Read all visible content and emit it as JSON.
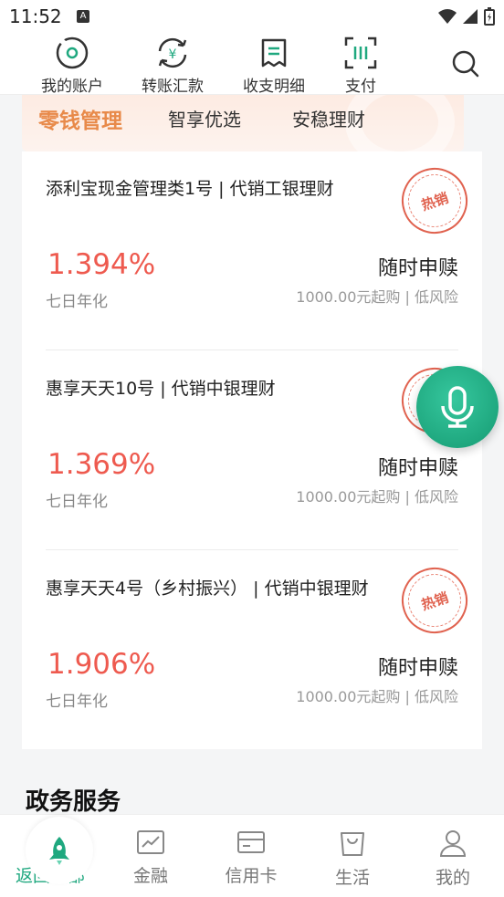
{
  "status_bar": {
    "time": "11:52"
  },
  "quick_actions": [
    {
      "label": "我的账户",
      "icon": "account-icon"
    },
    {
      "label": "转账汇款",
      "icon": "transfer-icon"
    },
    {
      "label": "收支明细",
      "icon": "statement-icon"
    },
    {
      "label": "支付",
      "icon": "scan-pay-icon"
    }
  ],
  "tabs": [
    {
      "label": "零钱管理",
      "active": true
    },
    {
      "label": "智享优选",
      "active": false
    },
    {
      "label": "安稳理财",
      "active": false
    }
  ],
  "products": [
    {
      "name": "添利宝现金管理类1号 | 代销工银理财",
      "rate": "1.394%",
      "rate_label": "七日年化",
      "redeem": "随时申赎",
      "min_buy": "1000.00元起购 | 低风险",
      "stamp": "热销"
    },
    {
      "name": "惠享天天10号 | 代销中银理财",
      "rate": "1.369%",
      "rate_label": "七日年化",
      "redeem": "随时申赎",
      "min_buy": "1000.00元起购 | 低风险",
      "stamp": "热销"
    },
    {
      "name": "惠享天天4号（乡村振兴） | 代销中银理财",
      "rate": "1.906%",
      "rate_label": "七日年化",
      "redeem": "随时申赎",
      "min_buy": "1000.00元起购 | 低风险",
      "stamp": "热销"
    }
  ],
  "section_title": "政务服务",
  "bottom_nav": [
    {
      "label": "返回顶部",
      "icon": "rocket-icon",
      "active": true
    },
    {
      "label": "金融",
      "icon": "chart-icon",
      "active": false
    },
    {
      "label": "信用卡",
      "icon": "card-icon",
      "active": false
    },
    {
      "label": "生活",
      "icon": "bag-icon",
      "active": false
    },
    {
      "label": "我的",
      "icon": "user-icon",
      "active": false
    }
  ],
  "colors": {
    "accent_green": "#1fa87f",
    "rate_red": "#ee5a4f",
    "tab_active": "#e88a4a",
    "stamp_red": "#e0624f"
  }
}
